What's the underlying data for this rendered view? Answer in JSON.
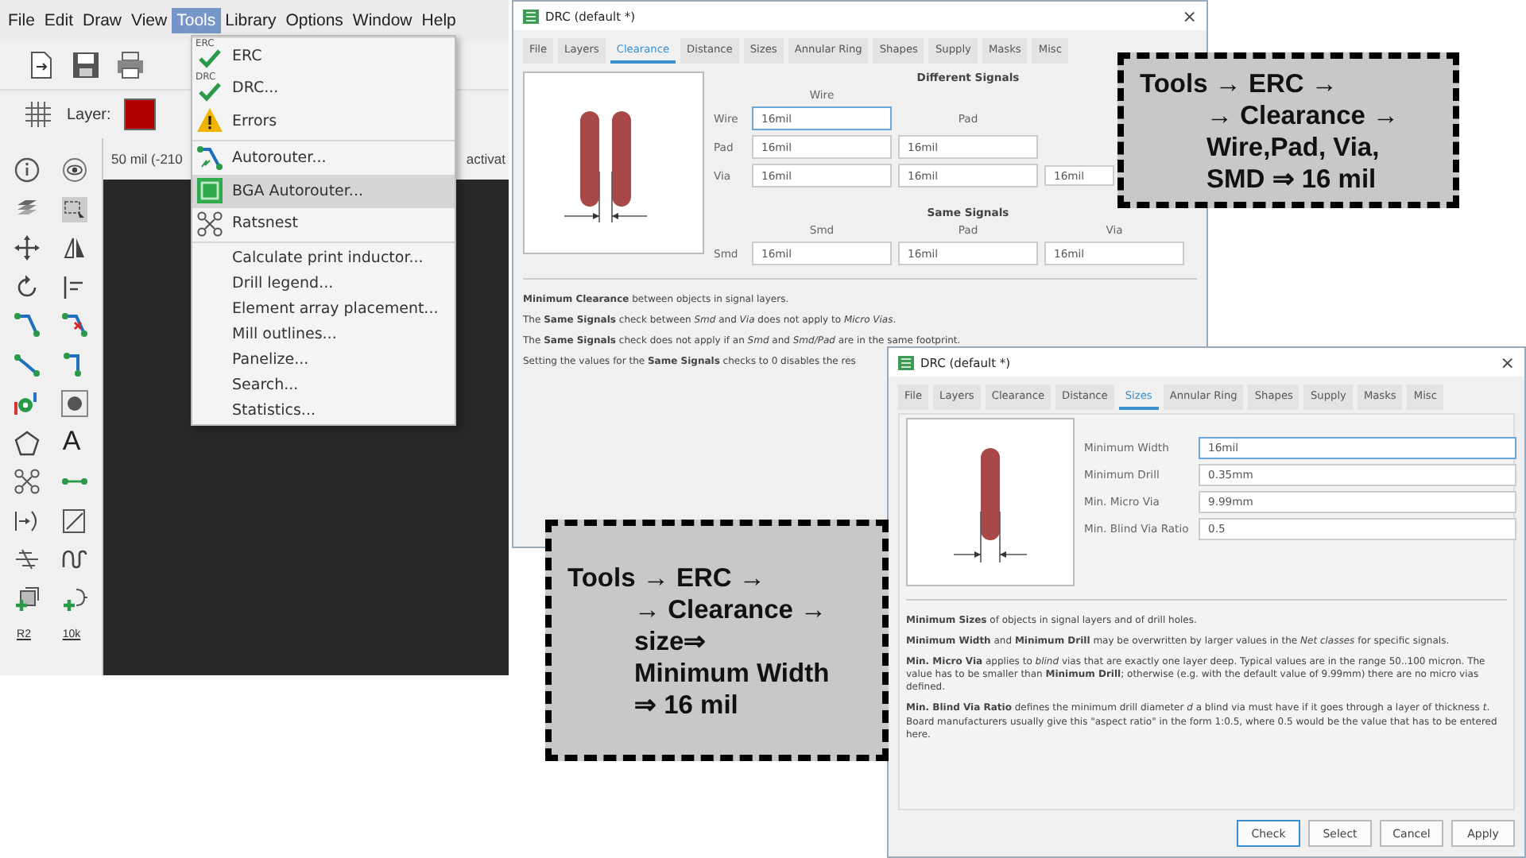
{
  "main_window": {
    "menu_bar": [
      {
        "label": "File",
        "selected": false
      },
      {
        "label": "Edit",
        "selected": false
      },
      {
        "label": "Draw",
        "selected": false
      },
      {
        "label": "View",
        "selected": false
      },
      {
        "label": "Tools",
        "selected": true
      },
      {
        "label": "Library",
        "selected": false
      },
      {
        "label": "Options",
        "selected": false
      },
      {
        "label": "Window",
        "selected": false
      },
      {
        "label": "Help",
        "selected": false
      }
    ],
    "layer_label": "Layer:",
    "coordinates": "50 mil (-210",
    "status_hint": "activat",
    "palette_texts": {
      "text_tool": "A",
      "name_label": "R2",
      "value_label": "10k"
    }
  },
  "tools_menu": {
    "groups": [
      [
        {
          "label": "ERC",
          "icon_text": "ERC",
          "selected": false
        },
        {
          "label": "DRC...",
          "icon_text": "DRC",
          "selected": false
        },
        {
          "label": "Errors",
          "selected": false
        }
      ],
      [
        {
          "label": "Autorouter...",
          "selected": false
        },
        {
          "label": "BGA Autorouter...",
          "selected": true
        },
        {
          "label": "Ratsnest",
          "selected": false
        }
      ],
      [
        {
          "label": "Calculate print inductor...",
          "selected": false
        },
        {
          "label": "Drill legend...",
          "selected": false
        },
        {
          "label": "Element array placement...",
          "selected": false
        },
        {
          "label": "Mill outlines...",
          "selected": false
        },
        {
          "label": "Panelize...",
          "selected": false
        },
        {
          "label": "Search...",
          "selected": false
        },
        {
          "label": "Statistics...",
          "selected": false
        }
      ]
    ]
  },
  "dialogs": [
    {
      "kind": "clearance",
      "title": "DRC (default *)",
      "close": "×",
      "tabs": [
        {
          "label": "File",
          "selected": false
        },
        {
          "label": "Layers",
          "selected": false
        },
        {
          "label": "Clearance",
          "selected": true
        },
        {
          "label": "Distance",
          "selected": false
        },
        {
          "label": "Sizes",
          "selected": false
        },
        {
          "label": "Annular Ring",
          "selected": false
        },
        {
          "label": "Shapes",
          "selected": false
        },
        {
          "label": "Supply",
          "selected": false
        },
        {
          "label": "Masks",
          "selected": false
        },
        {
          "label": "Misc",
          "selected": false
        }
      ],
      "different_signals": {
        "heading": "Different Signals",
        "columns": [
          "Wire",
          "Pad"
        ],
        "rows": [
          {
            "label": "Wire",
            "values": [
              {
                "value": "16mil",
                "focused": true
              }
            ]
          },
          {
            "label": "Pad",
            "values": [
              {
                "value": "16mil",
                "focused": false
              },
              {
                "value": "16mil",
                "focused": false
              }
            ]
          },
          {
            "label": "Via",
            "values": [
              {
                "value": "16mil",
                "focused": false
              },
              {
                "value": "16mil",
                "focused": false
              },
              {
                "value": "16mil",
                "focused": false
              }
            ]
          }
        ]
      },
      "same_signals": {
        "heading": "Same Signals",
        "columns": [
          "Smd",
          "Pad",
          "Via"
        ],
        "rows": [
          {
            "label": "Smd",
            "values": [
              {
                "value": "16mil",
                "focused": false
              },
              {
                "value": "16mil",
                "focused": false
              },
              {
                "value": "16mil",
                "focused": false
              }
            ]
          }
        ]
      },
      "notes": [
        "**Minimum Clearance** between objects in signal layers.",
        "The **Same Signals** check between *Smd* and *Via* does not apply to *Micro Vias*.",
        "The **Same Signals** check does not apply if an *Smd* and *Smd/Pad* are in the same footprint.",
        "Setting the values for the **Same Signals** checks to 0 disables the res"
      ]
    },
    {
      "kind": "sizes",
      "title": "DRC (default *)",
      "close": "×",
      "tabs": [
        {
          "label": "File",
          "selected": false
        },
        {
          "label": "Layers",
          "selected": false
        },
        {
          "label": "Clearance",
          "selected": false
        },
        {
          "label": "Distance",
          "selected": false
        },
        {
          "label": "Sizes",
          "selected": true
        },
        {
          "label": "Annular Ring",
          "selected": false
        },
        {
          "label": "Shapes",
          "selected": false
        },
        {
          "label": "Supply",
          "selected": false
        },
        {
          "label": "Masks",
          "selected": false
        },
        {
          "label": "Misc",
          "selected": false
        }
      ],
      "fields": [
        {
          "label": "Minimum Width",
          "value": "16mil",
          "focused": true
        },
        {
          "label": "Minimum Drill",
          "value": "0.35mm",
          "focused": false
        },
        {
          "label": "Min. Micro Via",
          "value": "9.99mm",
          "focused": false
        },
        {
          "label": "Min. Blind Via Ratio",
          "value": "0.5",
          "focused": false
        }
      ],
      "notes": [
        "**Minimum Sizes** of objects in signal layers and of drill holes.",
        "**Minimum Width** and **Minimum Drill** may be overwritten by larger values in the *Net classes* for specific signals.",
        "**Min. Micro Via** applies to *blind* vias that are exactly one layer deep. Typical values are in the range 50..100 micron. The value has to be smaller than **Minimum Drill**; otherwise (e.g. with the default value of 9.99mm) there are no micro vias defined.",
        "**Min. Blind Via Ratio** defines the minimum drill diameter *d* a blind via must have if it goes through a layer of thickness *t*. Board manufacturers usually give this \"aspect ratio\" in the form 1:0.5, where 0.5 would be the value that has to be entered here."
      ],
      "buttons": [
        {
          "label": "Check",
          "default": true
        },
        {
          "label": "Select",
          "default": false
        },
        {
          "label": "Cancel",
          "default": false
        },
        {
          "label": "Apply",
          "default": false
        }
      ]
    }
  ],
  "callouts": [
    {
      "lines": [
        "Tools → ERC →",
        "→ Clearance →",
        "Wire,Pad, Via,",
        "SMD ⇒ 16 mil"
      ]
    },
    {
      "lines": [
        "Tools → ERC →",
        "→ Clearance →",
        "size⇒",
        "Minimum Width",
        "⇒ 16 mil"
      ]
    }
  ]
}
